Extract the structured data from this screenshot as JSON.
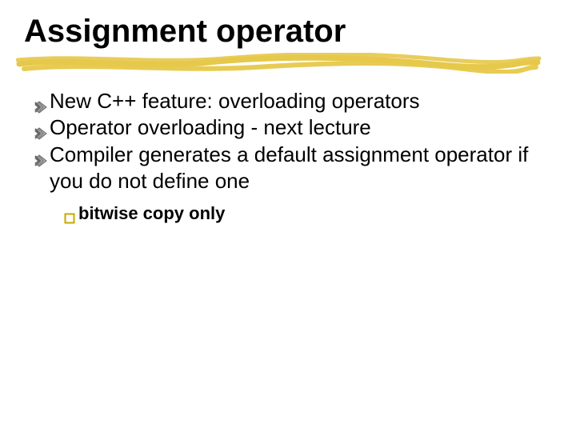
{
  "title": "Assignment operator",
  "bullets": [
    {
      "text": "New C++ feature: overloading operators"
    },
    {
      "text": "Operator overloading - next lecture"
    },
    {
      "text": "Compiler generates a default assignment operator if you do not define one",
      "sub": [
        {
          "text": "bitwise copy only"
        }
      ]
    }
  ],
  "colors": {
    "accent": "#e6c84a",
    "bullet1_fill": "#b3b3b3",
    "bullet1_stroke": "#666666",
    "bullet2_stroke": "#c9a900"
  }
}
